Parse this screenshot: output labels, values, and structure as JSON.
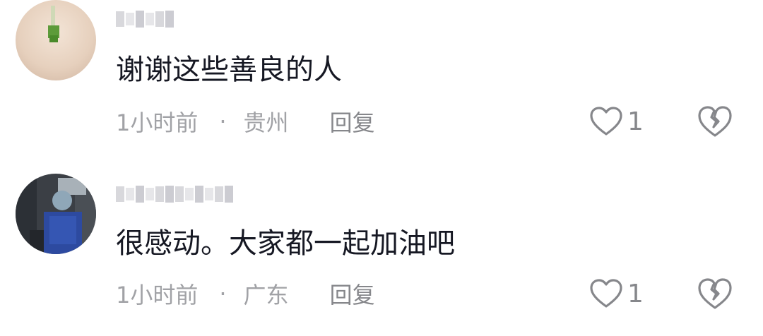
{
  "comments": [
    {
      "username": "大山",
      "content": "谢谢这些善良的人",
      "time": "1小时前",
      "separator": "·",
      "location": "贵州",
      "reply_label": "回复",
      "like_count": "1",
      "like_icon": "heart-outline-icon",
      "dislike_icon": "broken-heart-icon"
    },
    {
      "username": "",
      "content": "很感动。大家都一起加油吧",
      "time": "1小时前",
      "separator": "·",
      "location": "广东",
      "reply_label": "回复",
      "like_count": "1",
      "like_icon": "heart-outline-icon",
      "dislike_icon": "broken-heart-icon"
    }
  ],
  "colors": {
    "text_primary": "#161823",
    "text_meta": "#a1a2a6",
    "icon": "#86878b",
    "background": "#ffffff"
  }
}
